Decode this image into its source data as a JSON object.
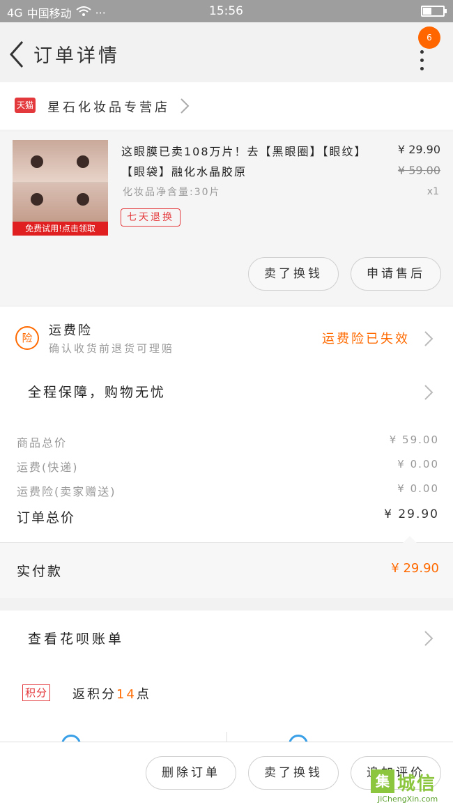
{
  "status_bar": {
    "carrier": "中国移动",
    "signal_text": "4G",
    "more": "···",
    "time": "15:56"
  },
  "header": {
    "title": "订单详情",
    "badge_count": "6"
  },
  "store": {
    "badge": "天猫",
    "name": "星石化妆品专营店"
  },
  "product": {
    "image_banner": "免费试用!点击领取",
    "name": "这眼膜已卖108万片！去【黑眼圈】【眼纹】【眼袋】融化水晶胶原",
    "spec": "化妆品净含量:30片",
    "tag": "七天退换",
    "price": "¥ 29.90",
    "original_price": "¥ 59.00",
    "quantity": "x1",
    "buttons": {
      "buy_again": "卖了换钱",
      "after_sale": "申请售后"
    }
  },
  "insurance": {
    "icon": "险",
    "title": "运费险",
    "subtitle": "确认收货前退货可理赔",
    "status": "运费险已失效"
  },
  "guarantee": {
    "label": "全程保障，购物无忧"
  },
  "summary": {
    "rows": [
      {
        "label": "商品总价",
        "value": "¥ 59.00"
      },
      {
        "label": "运费(快递)",
        "value": "¥ 0.00"
      },
      {
        "label": "运费险(卖家赠送)",
        "value": "¥ 0.00"
      }
    ],
    "total_label": "订单总价",
    "total_value": "¥ 29.90"
  },
  "paid": {
    "label": "实付款",
    "value": "¥ 29.90"
  },
  "bill": {
    "label": "查看花呗账单"
  },
  "points": {
    "badge": "积分",
    "prefix": "返积分",
    "amount": "14",
    "suffix": "点"
  },
  "bottom_bar": {
    "delete": "删除订单",
    "sell": "卖了换钱",
    "review": "追加评价"
  },
  "watermark": {
    "logo": "集",
    "name": "城信",
    "url": "JiChengXin.com"
  },
  "colors": {
    "accent": "#ff6a00",
    "tmall_red": "#e4393c",
    "badge_orange": "#ff6600"
  }
}
